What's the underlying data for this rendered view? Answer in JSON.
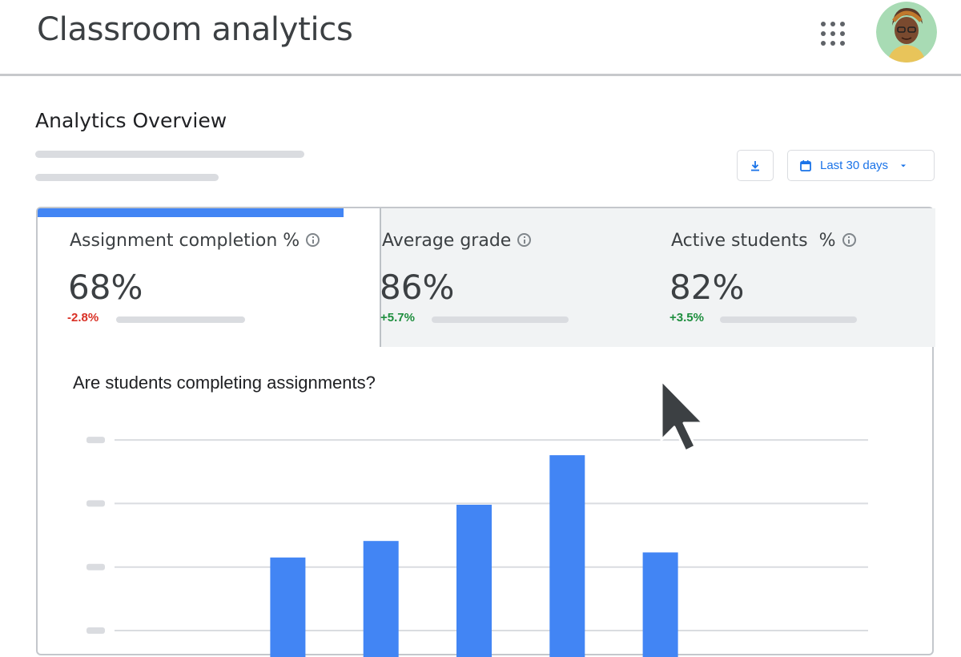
{
  "header": {
    "app_title": "Classroom analytics",
    "apps_icon": "apps-grid-icon",
    "avatar_icon": "user-avatar"
  },
  "overview": {
    "title": "Analytics Overview",
    "download_icon": "download-icon",
    "date_range": {
      "icon": "calendar-icon",
      "label": "Last 30 days",
      "dropdown_icon": "caret-down-icon"
    }
  },
  "metrics": [
    {
      "label": "Assignment completion %",
      "value": "68%",
      "delta": "-2.8%",
      "trend": "down",
      "selected": true
    },
    {
      "label": "Average grade",
      "value": "86%",
      "delta": "+5.7%",
      "trend": "up",
      "selected": false
    },
    {
      "label": "Active students  %",
      "value": "82%",
      "delta": "+3.5%",
      "trend": "up",
      "selected": false
    }
  ],
  "colors": {
    "accent": "#4285f4",
    "bar": "#4285f4",
    "negative": "#d93025",
    "positive": "#1e8e3e"
  },
  "chart_data": {
    "type": "bar",
    "title": "Are students completing assignments?",
    "xlabel": "",
    "ylabel": "",
    "ylim": [
      0,
      3
    ],
    "grid": true,
    "y_ticks_labeled": false,
    "categories": [
      "",
      "",
      "",
      "",
      "",
      "",
      "",
      ""
    ],
    "values": [
      0,
      0,
      1.15,
      1.41,
      1.98,
      2.76,
      1.23,
      0
    ]
  }
}
